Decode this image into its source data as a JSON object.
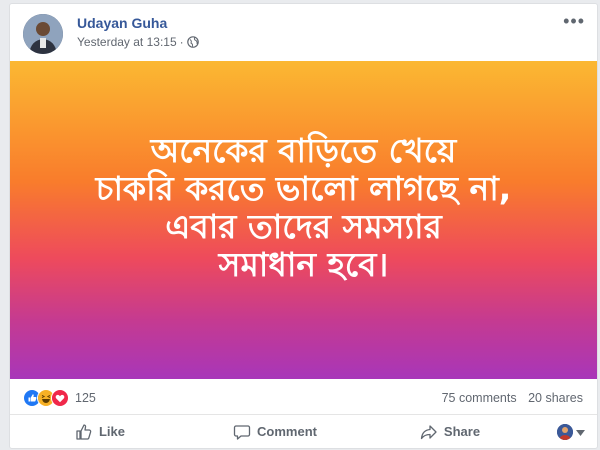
{
  "post": {
    "author": "Udayan Guha",
    "timestamp": "Yesterday at 13:15",
    "separator": "·",
    "more_label": "•••",
    "privacy_icon": "globe-icon",
    "status_lines": [
      "অনেকের বাড়িতে খেয়ে",
      "চাকরি করতে ভালো লাগছে না,",
      "এবার তাদের সমস্যার",
      "সমাধান হবে।"
    ],
    "background_colors": [
      "#fbb832",
      "#f97c2c",
      "#ee4a5c",
      "#c43a92",
      "#a836b9"
    ]
  },
  "stats": {
    "reactions": [
      "like-reaction-icon",
      "haha-reaction-icon",
      "love-reaction-icon"
    ],
    "reaction_count": "125",
    "comments": "75 comments",
    "shares": "20 shares"
  },
  "actions": {
    "like": "Like",
    "comment": "Comment",
    "share": "Share"
  },
  "colors": {
    "author": "#365899",
    "meta": "#616770",
    "like_blue": "#2078f4",
    "haha_yellow": "#f7b125",
    "love_red": "#f0284a"
  }
}
